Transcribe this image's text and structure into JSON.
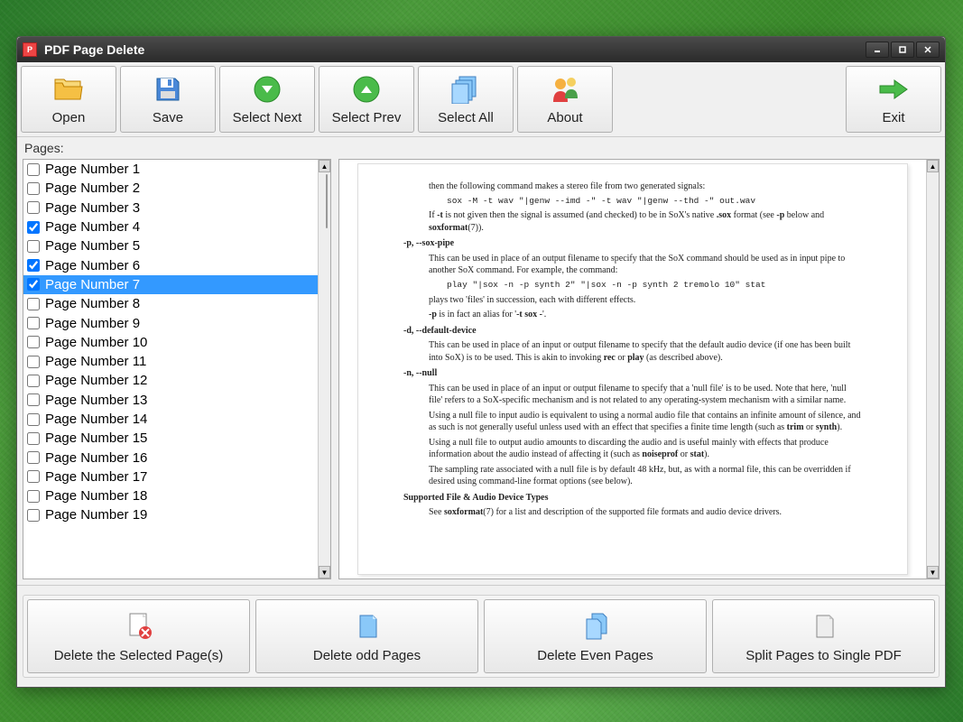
{
  "window": {
    "title": "PDF Page Delete"
  },
  "toolbar": {
    "open": "Open",
    "save": "Save",
    "select_next": "Select Next",
    "select_prev": "Select Prev",
    "select_all": "Select All",
    "about": "About",
    "exit": "Exit"
  },
  "pages_label": "Pages:",
  "pages": [
    {
      "label": "Page Number 1",
      "checked": false,
      "selected": false
    },
    {
      "label": "Page Number 2",
      "checked": false,
      "selected": false
    },
    {
      "label": "Page Number 3",
      "checked": false,
      "selected": false
    },
    {
      "label": "Page Number 4",
      "checked": true,
      "selected": false
    },
    {
      "label": "Page Number 5",
      "checked": false,
      "selected": false
    },
    {
      "label": "Page Number 6",
      "checked": true,
      "selected": false
    },
    {
      "label": "Page Number 7",
      "checked": true,
      "selected": true
    },
    {
      "label": "Page Number 8",
      "checked": false,
      "selected": false
    },
    {
      "label": "Page Number 9",
      "checked": false,
      "selected": false
    },
    {
      "label": "Page Number 10",
      "checked": false,
      "selected": false
    },
    {
      "label": "Page Number 11",
      "checked": false,
      "selected": false
    },
    {
      "label": "Page Number 12",
      "checked": false,
      "selected": false
    },
    {
      "label": "Page Number 13",
      "checked": false,
      "selected": false
    },
    {
      "label": "Page Number 14",
      "checked": false,
      "selected": false
    },
    {
      "label": "Page Number 15",
      "checked": false,
      "selected": false
    },
    {
      "label": "Page Number 16",
      "checked": false,
      "selected": false
    },
    {
      "label": "Page Number 17",
      "checked": false,
      "selected": false
    },
    {
      "label": "Page Number 18",
      "checked": false,
      "selected": false
    },
    {
      "label": "Page Number 19",
      "checked": false,
      "selected": false
    }
  ],
  "bottom": {
    "delete_selected": "Delete the Selected Page(s)",
    "delete_odd": "Delete odd Pages",
    "delete_even": "Delete Even Pages",
    "split": "Split Pages to Single PDF"
  },
  "preview": {
    "l1": "then the following command makes a stereo file from two generated signals:",
    "c1": "sox -M -t wav \"|genw --imd -\" -t wav \"|genw --thd -\" out.wav",
    "l2a": "If ",
    "l2b": "-t",
    "l2c": " is not given then the signal is assumed (and checked) to be in SoX's native ",
    "l2d": ".sox",
    "l2e": " format (see ",
    "l2f": "-p",
    "l2g": " below and ",
    "l2h": "soxformat",
    "l2i": "(7)).",
    "opt_p": "-p, --sox-pipe",
    "p1": "This can be used in place of an output filename to specify that the SoX command should be used as in input pipe to another SoX command. For example, the command:",
    "c2": "play \"|sox -n -p synth 2\" \"|sox -n -p synth 2 tremolo 10\" stat",
    "p2": "plays two 'files' in succession, each with different effects.",
    "p3a": "-p",
    "p3b": " is in fact an alias for '",
    "p3c": "-t sox -",
    "p3d": "'.",
    "opt_d": "-d, --default-device",
    "d1a": "This can be used in place of an input or output filename to specify that the default audio device (if one has been built into SoX) is to be used. This is akin to invoking ",
    "d1b": "rec",
    "d1c": " or ",
    "d1d": "play",
    "d1e": " (as described above).",
    "opt_n": "-n, --null",
    "n1": "This can be used in place of an input or output filename to specify that a 'null file' is to be used. Note that here, 'null file' refers to a SoX-specific mechanism and is not related to any operating-system mechanism with a similar name.",
    "n2a": "Using a null file to input audio is equivalent to using a normal audio file that contains an infinite amount of silence, and as such is not generally useful unless used with an effect that specifies a finite time length (such as ",
    "n2b": "trim",
    "n2c": " or ",
    "n2d": "synth",
    "n2e": ").",
    "n3a": "Using a null file to output audio amounts to discarding the audio and is useful mainly with effects that produce information about the audio instead of affecting it (such as ",
    "n3b": "noiseprof",
    "n3c": " or ",
    "n3d": "stat",
    "n3e": ").",
    "n4": "The sampling rate associated with a null file is by default 48 kHz, but, as with a normal file, this can be overridden if desired using command-line format options (see below).",
    "sup": "Supported File & Audio Device Types",
    "sup2a": "See ",
    "sup2b": "soxformat",
    "sup2c": "(7) for a list and description of the supported file formats and audio device drivers."
  }
}
